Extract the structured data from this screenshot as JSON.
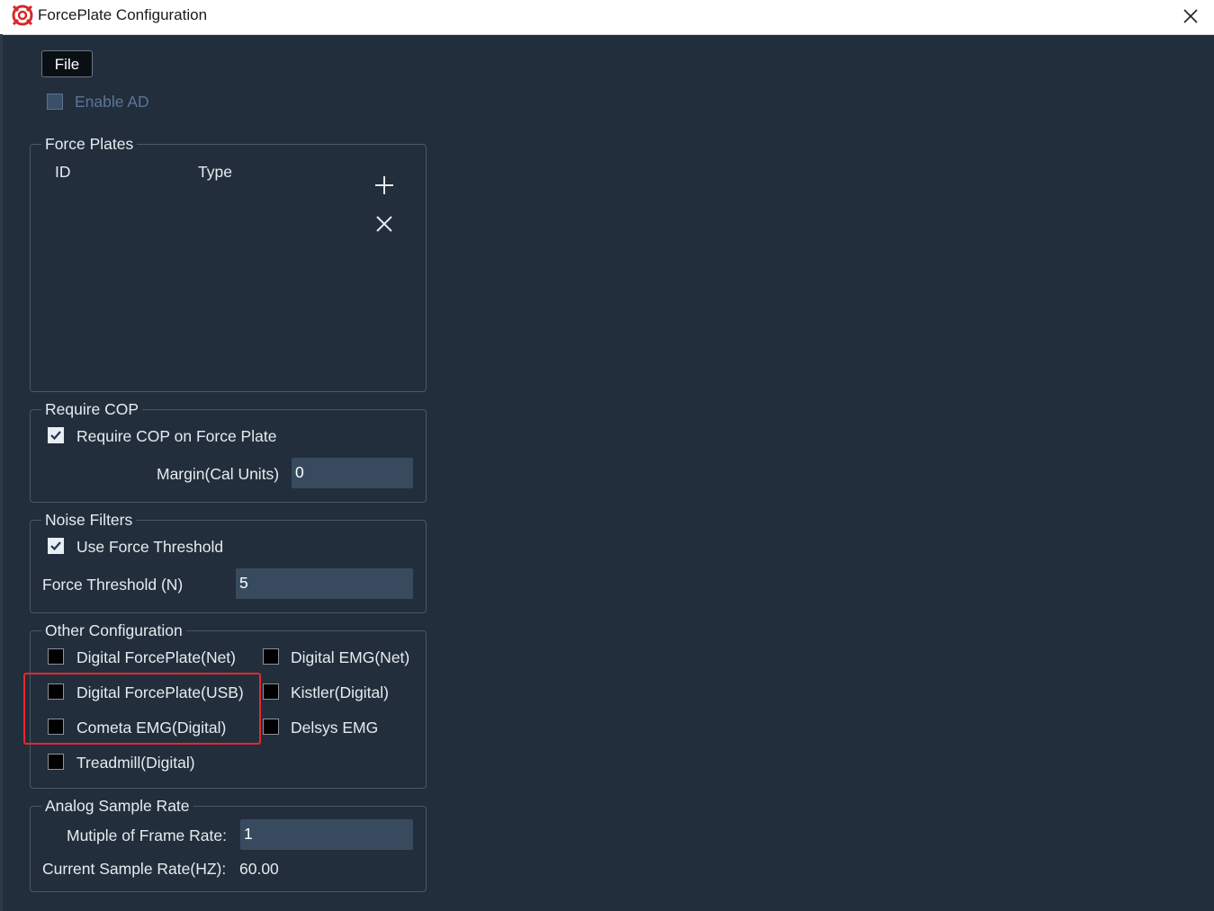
{
  "window": {
    "title": "ForcePlate Configuration"
  },
  "menu": {
    "file_label": "File"
  },
  "enable_ad": {
    "label": "Enable AD",
    "checked": false,
    "disabled": true
  },
  "force_plates": {
    "title": "Force Plates",
    "columns": [
      "ID",
      "Type"
    ],
    "rows": []
  },
  "require_cop": {
    "title": "Require COP",
    "checkbox_label": "Require COP on Force Plate",
    "checked": true,
    "margin_label": "Margin(Cal Units)",
    "margin_value": "0"
  },
  "noise_filters": {
    "title": "Noise Filters",
    "checkbox_label": "Use Force Threshold",
    "checked": true,
    "threshold_label": "Force Threshold (N)",
    "threshold_value": "5"
  },
  "other_config": {
    "title": "Other Configuration",
    "options": [
      {
        "label": "Digital ForcePlate(Net)",
        "checked": false
      },
      {
        "label": "Digital EMG(Net)",
        "checked": false
      },
      {
        "label": "Digital ForcePlate(USB)",
        "checked": false
      },
      {
        "label": "Kistler(Digital)",
        "checked": false
      },
      {
        "label": "Cometa EMG(Digital)",
        "checked": false
      },
      {
        "label": "Delsys EMG",
        "checked": false
      },
      {
        "label": "Treadmill(Digital)",
        "checked": false
      }
    ]
  },
  "analog_rate": {
    "title": "Analog Sample Rate",
    "multiple_label": "Mutiple of Frame Rate:",
    "multiple_value": "1",
    "current_label": "Current Sample Rate(HZ):",
    "current_value": "60.00"
  },
  "colors": {
    "background": "#222e3c",
    "input_bg": "#384b5e",
    "highlight": "#e8282c",
    "titlebar": "#ffffff"
  }
}
